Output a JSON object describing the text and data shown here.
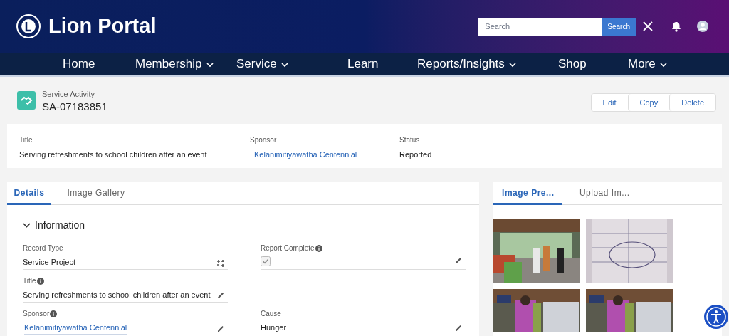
{
  "header": {
    "brand": "Lion Portal",
    "search": {
      "placeholder": "Search",
      "button": "Search"
    }
  },
  "nav": [
    {
      "label": "Home",
      "dropdown": false
    },
    {
      "label": "Membership",
      "dropdown": true
    },
    {
      "label": "Service",
      "dropdown": true
    },
    {
      "label": "Learn",
      "dropdown": false
    },
    {
      "label": "Reports/Insights",
      "dropdown": true
    },
    {
      "label": "Shop",
      "dropdown": false
    },
    {
      "label": "More",
      "dropdown": true
    }
  ],
  "record": {
    "object_type": "Service Activity",
    "name": "SA-07183851",
    "actions": [
      "Edit",
      "Copy",
      "Delete"
    ]
  },
  "highlights": [
    {
      "label": "Title",
      "value": "Serving refreshments to school children after an event",
      "kind": "text"
    },
    {
      "label": "Sponsor",
      "value": "Kelanimitiyawatha Centennial",
      "kind": "link"
    },
    {
      "label": "Status",
      "value": "Reported",
      "kind": "text"
    }
  ],
  "detail_tabs": [
    {
      "label": "Details",
      "selected": true
    },
    {
      "label": "Image Gallery",
      "selected": false
    }
  ],
  "section": {
    "title": "Information",
    "expanded": true
  },
  "field_rows": [
    {
      "left": {
        "label": "Record Type",
        "info": false,
        "kind": "record_type",
        "value": "Service Project"
      },
      "right": {
        "label": "Report Complete",
        "info": true,
        "kind": "checkbox",
        "checked": true,
        "editable": true
      }
    },
    {
      "left": {
        "label": "Title",
        "info": true,
        "kind": "text",
        "value": "Serving refreshments to school children after an event",
        "editable": true
      }
    },
    {
      "left": {
        "label": "Sponsor",
        "info": true,
        "kind": "link",
        "value": "Kelanimitiyawatha Centennial",
        "editable": true
      },
      "right": {
        "label": "Cause",
        "info": false,
        "kind": "text",
        "value": "Hunger",
        "editable": true
      }
    }
  ],
  "image_tabs": [
    {
      "label": "Image Pre...",
      "selected": true
    },
    {
      "label": "Upload Im...",
      "selected": false
    }
  ]
}
